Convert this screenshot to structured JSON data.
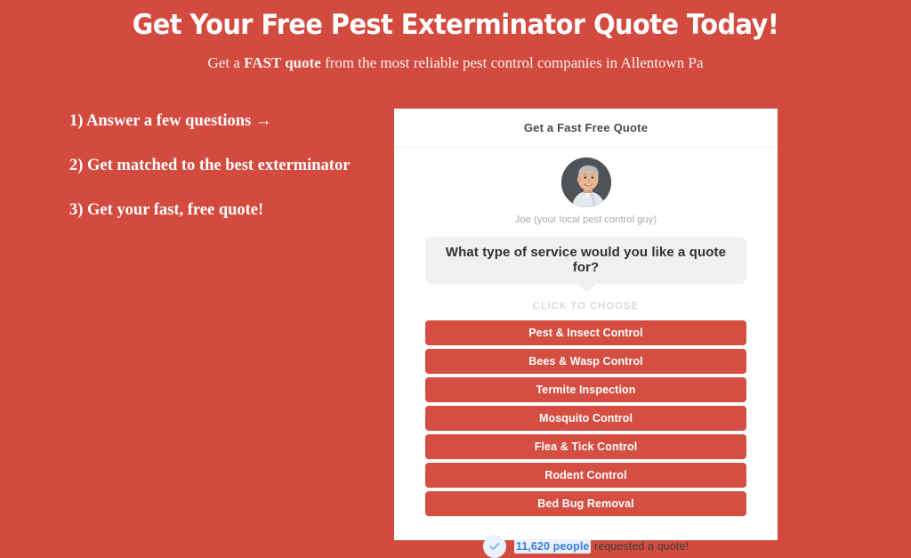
{
  "theme": {
    "background": "#d34a3e",
    "button_red": "#d44f42",
    "accent_blue": "#3b7ddd",
    "badge_blue_bg": "#eaf2fe"
  },
  "hero": {
    "title": "Get Your Free Pest Exterminator Quote Today!",
    "subtitle_before": "Get a ",
    "subtitle_bold": "FAST quote",
    "subtitle_after": " from the most reliable pest control companies in Allentown Pa"
  },
  "steps": [
    "1) Answer a few questions →",
    "2) Get matched to the best exterminator",
    "3) Get your fast, free quote!"
  ],
  "widget": {
    "header_title": "Get a Fast Free Quote",
    "avatar_caption": "Joe (your local pest control guy)",
    "question": "What type of service would you like a quote for?",
    "click_hint": "CLICK TO CHOOSE",
    "options": [
      "Pest & Insect Control",
      "Bees & Wasp Control",
      "Termite Inspection",
      "Mosquito Control",
      "Flea & Tick Control",
      "Rodent Control",
      "Bed Bug Removal"
    ],
    "footer": {
      "count": "11,620 people",
      "suffix": " requested a quote!"
    }
  }
}
